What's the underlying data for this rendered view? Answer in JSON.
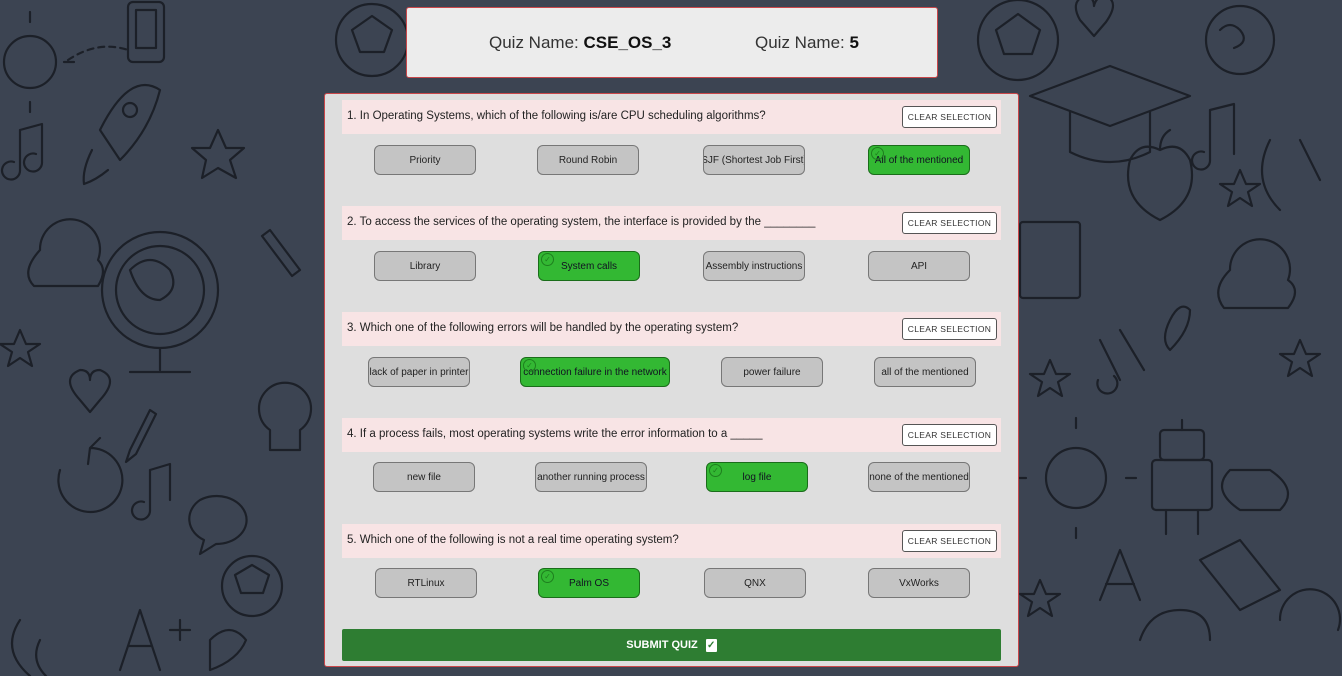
{
  "header": {
    "quiz_name_label_1": "Quiz Name: ",
    "quiz_name_value": "CSE_OS_3",
    "quiz_name_label_2": "Quiz Name: ",
    "quiz_count_value": "5"
  },
  "clear_label": "CLEAR SELECTION",
  "questions": [
    {
      "text": "1. In Operating Systems, which of the following is/are CPU scheduling algorithms?",
      "options": [
        "Priority",
        "Round Robin",
        "SJF (Shortest Job First)",
        "All of the mentioned"
      ],
      "selected_index": 3
    },
    {
      "text": "2. To access the services of the operating system, the interface is provided by the ________",
      "options": [
        "Library",
        "System calls",
        "Assembly instructions",
        "API"
      ],
      "selected_index": 1
    },
    {
      "text": "3. Which one of the following errors will be handled by the operating system?",
      "options": [
        "lack of paper in printer",
        "connection failure in the network",
        "power failure",
        "all of the mentioned"
      ],
      "selected_index": 1
    },
    {
      "text": "4. If a process fails, most operating systems write the error information to a _____",
      "options": [
        "new file",
        "another running process",
        "log file",
        "none of the mentioned"
      ],
      "selected_index": 2
    },
    {
      "text": "5. Which one of the following is not a real time operating system?",
      "options": [
        "RTLinux",
        "Palm OS",
        "QNX",
        "VxWorks"
      ],
      "selected_index": 1
    }
  ],
  "submit_label": "SUBMIT QUIZ",
  "icons": {
    "check": "check-circle-icon",
    "submit": "clipboard-check-icon"
  },
  "colors": {
    "background": "#3c4452",
    "selected_option": "#33b833",
    "submit_button": "#2e7d32",
    "question_row": "#f8e4e5",
    "card_border": "#c9474a"
  }
}
